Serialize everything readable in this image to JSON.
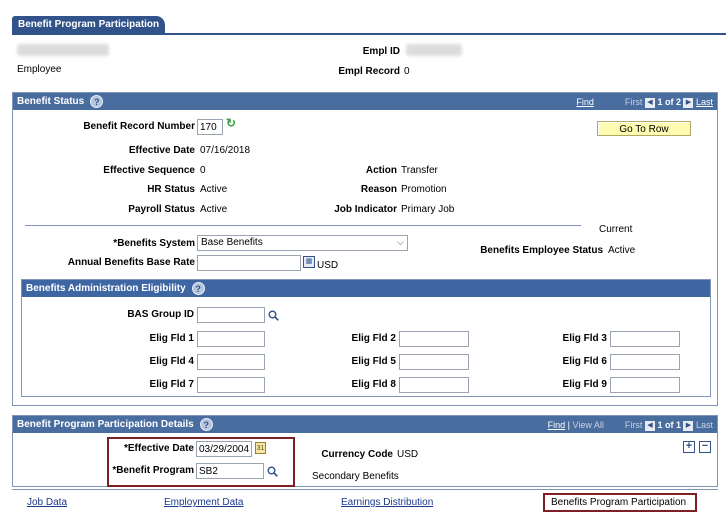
{
  "tab": {
    "label": "Benefit Program Participation"
  },
  "employee": {
    "employee_label": "Employee",
    "empl_id_label": "Empl ID",
    "empl_record_label": "Empl Record",
    "empl_record_value": "0"
  },
  "benefit_status": {
    "title": "Benefit Status",
    "nav": {
      "find": "Find",
      "first": "First",
      "count": "1 of 2",
      "last": "Last"
    },
    "go_to_row": "Go To Row",
    "benefit_record_number_label": "Benefit Record Number",
    "benefit_record_number": "170",
    "effective_date_label": "Effective Date",
    "effective_date": "07/16/2018",
    "effective_sequence_label": "Effective Sequence",
    "effective_sequence": "0",
    "action_label": "Action",
    "action": "Transfer",
    "hr_status_label": "HR Status",
    "hr_status": "Active",
    "reason_label": "Reason",
    "reason": "Promotion",
    "payroll_status_label": "Payroll Status",
    "payroll_status": "Active",
    "job_indicator_label": "Job Indicator",
    "job_indicator": "Primary Job",
    "current": "Current",
    "benefits_system_label": "*Benefits System",
    "benefits_system": "Base Benefits",
    "annual_base_rate_label": "Annual Benefits Base Rate",
    "currency": "USD",
    "employee_status_label": "Benefits Employee Status",
    "employee_status": "Active"
  },
  "eligibility": {
    "title": "Benefits Administration Eligibility",
    "bas_group_id_label": "BAS Group ID",
    "fields": [
      "Elig Fld 1",
      "Elig Fld 2",
      "Elig Fld 3",
      "Elig Fld 4",
      "Elig Fld 5",
      "Elig Fld 6",
      "Elig Fld 7",
      "Elig Fld 8",
      "Elig Fld 9"
    ]
  },
  "participation": {
    "title": "Benefit Program Participation Details",
    "nav": {
      "find": "Find",
      "view_all": "View All",
      "first": "First",
      "count": "1 of 1",
      "last": "Last"
    },
    "effective_date_label": "*Effective Date",
    "effective_date": "03/29/2004",
    "benefit_program_label": "*Benefit Program",
    "benefit_program": "SB2",
    "currency_code_label": "Currency Code",
    "currency_code": "USD",
    "program_description": "Secondary Benefits"
  },
  "footer_links": [
    "Job Data",
    "Employment Data",
    "Earnings Distribution",
    "Benefits Program Participation"
  ],
  "colors": {
    "header": "#4a6da0",
    "tab": "#31538a",
    "highlight": "#7d1f27",
    "button": "#fffbb0"
  }
}
